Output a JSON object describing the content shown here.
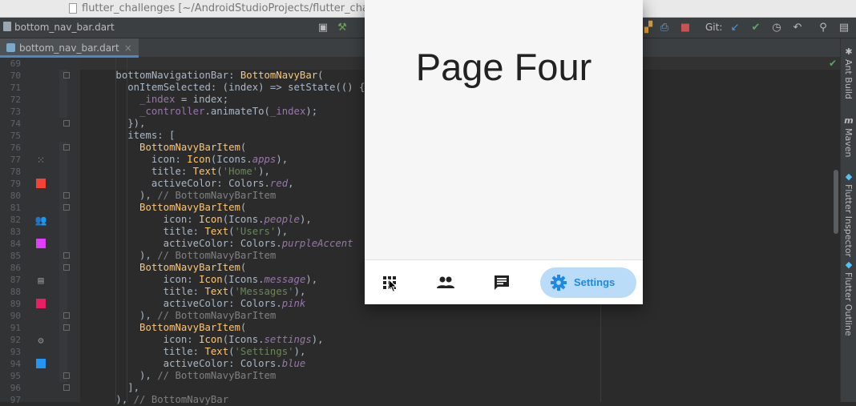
{
  "window": {
    "title": "flutter_challenges [~/AndroidStudioProjects/flutter_challen"
  },
  "toolbar": {
    "breadcrumb_file": "bottom_nav_bar.dart",
    "git_label": "Git:"
  },
  "tabs": [
    {
      "label": "bottom_nav_bar.dart",
      "close": "×"
    }
  ],
  "gutter": {
    "line_numbers": [
      "69",
      "70",
      "71",
      "72",
      "73",
      "74",
      "75",
      "76",
      "77",
      "78",
      "79",
      "80",
      "81",
      "82",
      "83",
      "84",
      "85",
      "86",
      "87",
      "88",
      "89",
      "90",
      "91",
      "92",
      "93",
      "94",
      "95",
      "96",
      "97"
    ],
    "color_swatches": [
      "#f44336",
      "#e040fb",
      "#e91e63",
      "#2196f3"
    ]
  },
  "right_strip": {
    "ant_build": "Ant Build",
    "maven": "Maven",
    "flutter_inspector": "Flutter Inspector",
    "flutter_outline": "Flutter Outline"
  },
  "code": [
    "",
    [
      [
        "t",
        "      bottomNavigationBar: "
      ],
      [
        "c",
        "BottomNavyBar"
      ],
      [
        "t",
        "("
      ]
    ],
    [
      [
        "t",
        "        onItemSelected: (index) => setState(() {"
      ]
    ],
    [
      [
        "t",
        "          "
      ],
      [
        "f",
        "_index"
      ],
      [
        "t",
        " = index;"
      ]
    ],
    [
      [
        "t",
        "          "
      ],
      [
        "f",
        "_controller"
      ],
      [
        "t",
        ".animateTo("
      ],
      [
        "f",
        "_index"
      ],
      [
        "t",
        ");"
      ]
    ],
    [
      [
        "t",
        "        }),"
      ]
    ],
    [
      [
        "t",
        "        items: ["
      ]
    ],
    [
      [
        "t",
        "          "
      ],
      [
        "c",
        "BottomNavyBarItem"
      ],
      [
        "t",
        "("
      ]
    ],
    [
      [
        "t",
        "            icon: "
      ],
      [
        "c",
        "Icon"
      ],
      [
        "t",
        "(Icons."
      ],
      [
        "p",
        "apps"
      ],
      [
        "t",
        "),"
      ]
    ],
    [
      [
        "t",
        "            title: "
      ],
      [
        "c",
        "Text"
      ],
      [
        "t",
        "("
      ],
      [
        "s",
        "'Home'"
      ],
      [
        "t",
        "),"
      ]
    ],
    [
      [
        "t",
        "            activeColor: Colors."
      ],
      [
        "p",
        "red"
      ],
      [
        "t",
        ","
      ]
    ],
    [
      [
        "t",
        "          ), "
      ],
      [
        "m",
        "// BottomNavyBarItem"
      ]
    ],
    [
      [
        "t",
        "          "
      ],
      [
        "c",
        "BottomNavyBarItem"
      ],
      [
        "t",
        "("
      ]
    ],
    [
      [
        "t",
        "              icon: "
      ],
      [
        "c",
        "Icon"
      ],
      [
        "t",
        "(Icons."
      ],
      [
        "p",
        "people"
      ],
      [
        "t",
        "),"
      ]
    ],
    [
      [
        "t",
        "              title: "
      ],
      [
        "c",
        "Text"
      ],
      [
        "t",
        "("
      ],
      [
        "s",
        "'Users'"
      ],
      [
        "t",
        "),"
      ]
    ],
    [
      [
        "t",
        "              activeColor: Colors."
      ],
      [
        "p",
        "purpleAccent"
      ]
    ],
    [
      [
        "t",
        "          ), "
      ],
      [
        "m",
        "// BottomNavyBarItem"
      ]
    ],
    [
      [
        "t",
        "          "
      ],
      [
        "c",
        "BottomNavyBarItem"
      ],
      [
        "t",
        "("
      ]
    ],
    [
      [
        "t",
        "              icon: "
      ],
      [
        "c",
        "Icon"
      ],
      [
        "t",
        "(Icons."
      ],
      [
        "p",
        "message"
      ],
      [
        "t",
        "),"
      ]
    ],
    [
      [
        "t",
        "              title: "
      ],
      [
        "c",
        "Text"
      ],
      [
        "t",
        "("
      ],
      [
        "s",
        "'Messages'"
      ],
      [
        "t",
        "),"
      ]
    ],
    [
      [
        "t",
        "              activeColor: Colors."
      ],
      [
        "p",
        "pink"
      ]
    ],
    [
      [
        "t",
        "          ), "
      ],
      [
        "m",
        "// BottomNavyBarItem"
      ]
    ],
    [
      [
        "t",
        "          "
      ],
      [
        "c",
        "BottomNavyBarItem"
      ],
      [
        "t",
        "("
      ]
    ],
    [
      [
        "t",
        "              icon: "
      ],
      [
        "c",
        "Icon"
      ],
      [
        "t",
        "(Icons."
      ],
      [
        "p",
        "settings"
      ],
      [
        "t",
        "),"
      ]
    ],
    [
      [
        "t",
        "              title: "
      ],
      [
        "c",
        "Text"
      ],
      [
        "t",
        "("
      ],
      [
        "s",
        "'Settings'"
      ],
      [
        "t",
        "),"
      ]
    ],
    [
      [
        "t",
        "              activeColor: Colors."
      ],
      [
        "p",
        "blue"
      ]
    ],
    [
      [
        "t",
        "          ), "
      ],
      [
        "m",
        "// BottomNavyBarItem"
      ]
    ],
    [
      [
        "t",
        "        ],"
      ]
    ],
    [
      [
        "t",
        "      ), "
      ],
      [
        "m",
        "// BottomNavyBar"
      ]
    ]
  ],
  "emulator": {
    "page_title": "Page Four",
    "nav_items": [
      {
        "icon": "apps-icon"
      },
      {
        "icon": "people-icon"
      },
      {
        "icon": "message-icon"
      },
      {
        "icon": "settings-icon",
        "label": "Settings",
        "active": true
      }
    ],
    "active_color": "#1e88e5"
  },
  "colors": {
    "editor_bg": "#2b2b2b",
    "gutter_bg": "#313335",
    "active_pill": "#bbdcf9"
  }
}
